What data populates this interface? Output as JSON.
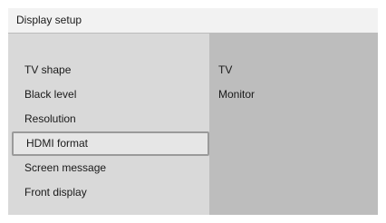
{
  "header": {
    "title": "Display setup"
  },
  "menu": {
    "items": [
      {
        "label": "TV shape"
      },
      {
        "label": "Black level"
      },
      {
        "label": "Resolution"
      },
      {
        "label": "HDMI format",
        "selected": true
      },
      {
        "label": "Screen message"
      },
      {
        "label": "Front display"
      }
    ]
  },
  "options": {
    "items": [
      {
        "label": "TV"
      },
      {
        "label": "Monitor"
      }
    ]
  },
  "colors": {
    "panel_bg": "#d9d9d9",
    "options_bg": "#bdbdbd",
    "title_bar_bg": "#f2f2f2",
    "selection_border": "#9a9a9a"
  }
}
